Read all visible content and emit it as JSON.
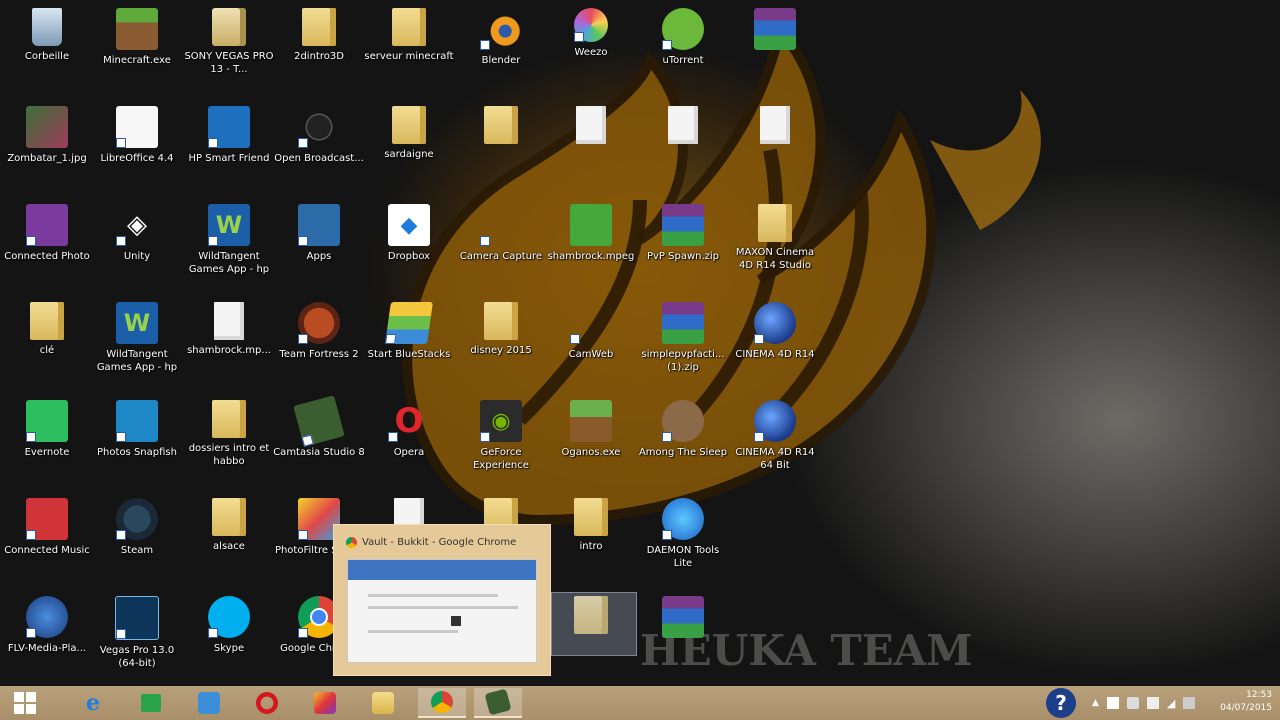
{
  "desktop": {
    "icons": [
      {
        "label": "Corbeille",
        "kind": "bin",
        "shortcut": false
      },
      {
        "label": "Minecraft.exe",
        "kind": "mc",
        "shortcut": false
      },
      {
        "label": "SONY VEGAS PRO 13 - T...",
        "kind": "sony",
        "shortcut": false
      },
      {
        "label": "2dintro3D",
        "kind": "folder",
        "shortcut": false
      },
      {
        "label": "serveur minecraft",
        "kind": "folder",
        "shortcut": false
      },
      {
        "label": "Blender",
        "kind": "blender",
        "shortcut": true
      },
      {
        "label": "Weezo",
        "kind": "weezo",
        "shortcut": true
      },
      {
        "label": "uTorrent",
        "kind": "ut",
        "shortcut": true
      },
      {
        "label": "",
        "kind": "rar",
        "shortcut": false
      },
      {
        "label": "Zombatar_1.jpg",
        "kind": "zombie",
        "shortcut": false
      },
      {
        "label": "LibreOffice 4.4",
        "kind": "lo",
        "shortcut": true
      },
      {
        "label": "HP Smart Friend",
        "kind": "hp",
        "shortcut": true
      },
      {
        "label": "Open Broadcast...",
        "kind": "obs",
        "shortcut": true
      },
      {
        "label": "sardaigne",
        "kind": "folder",
        "shortcut": false
      },
      {
        "label": "",
        "kind": "folder",
        "shortcut": false
      },
      {
        "label": "",
        "kind": "file",
        "shortcut": false
      },
      {
        "label": "",
        "kind": "file",
        "shortcut": false
      },
      {
        "label": "",
        "kind": "file",
        "shortcut": false
      },
      {
        "label": "Connected Photo",
        "kind": "cp",
        "shortcut": true
      },
      {
        "label": "Unity",
        "kind": "unity",
        "shortcut": true
      },
      {
        "label": "WildTangent Games App - hp",
        "kind": "wt",
        "shortcut": true
      },
      {
        "label": "Apps",
        "kind": "apps",
        "shortcut": true
      },
      {
        "label": "Dropbox",
        "kind": "dropbox",
        "shortcut": false
      },
      {
        "label": "Camera Capture",
        "kind": "cam",
        "shortcut": true
      },
      {
        "label": "shambrock.mpeg",
        "kind": "mpeg",
        "shortcut": false
      },
      {
        "label": "PvP Spawn.zip",
        "kind": "rar",
        "shortcut": false
      },
      {
        "label": "MAXON Cinema 4D R14 Studio",
        "kind": "folder",
        "shortcut": false
      },
      {
        "label": "clé",
        "kind": "folder",
        "shortcut": false
      },
      {
        "label": "WildTangent Games App - hp",
        "kind": "wt",
        "shortcut": false
      },
      {
        "label": "shambrock.mp...",
        "kind": "file",
        "shortcut": false
      },
      {
        "label": "Team Fortress 2",
        "kind": "tf2",
        "shortcut": true
      },
      {
        "label": "Start BlueStacks",
        "kind": "bs",
        "shortcut": true
      },
      {
        "label": "disney 2015",
        "kind": "folder",
        "shortcut": false
      },
      {
        "label": "CamWeb",
        "kind": "cam",
        "shortcut": true
      },
      {
        "label": "simplepvpfacti... (1).zip",
        "kind": "rar",
        "shortcut": false
      },
      {
        "label": "CINEMA 4D R14",
        "kind": "c4d",
        "shortcut": true
      },
      {
        "label": "Evernote",
        "kind": "evernote",
        "shortcut": true
      },
      {
        "label": "Photos Snapfish",
        "kind": "snap",
        "shortcut": true
      },
      {
        "label": "dossiers intro et habbo",
        "kind": "folder",
        "shortcut": false
      },
      {
        "label": "Camtasia Studio 8",
        "kind": "camtasia",
        "shortcut": true
      },
      {
        "label": "Opera",
        "kind": "opera",
        "shortcut": true
      },
      {
        "label": "GeForce Experience",
        "kind": "nvidia",
        "shortcut": true
      },
      {
        "label": "Oganos.exe",
        "kind": "mcexe",
        "shortcut": false
      },
      {
        "label": "Among The Sleep",
        "kind": "among",
        "shortcut": true
      },
      {
        "label": "CINEMA 4D R14 64 Bit",
        "kind": "c4d",
        "shortcut": true
      },
      {
        "label": "Connected Music",
        "kind": "music",
        "shortcut": true
      },
      {
        "label": "Steam",
        "kind": "steam",
        "shortcut": true
      },
      {
        "label": "alsace",
        "kind": "folder",
        "shortcut": false
      },
      {
        "label": "PhotoFiltre Studio",
        "kind": "pstudio",
        "shortcut": true
      },
      {
        "label": "",
        "kind": "file",
        "shortcut": false
      },
      {
        "label": "",
        "kind": "folder",
        "shortcut": false
      },
      {
        "label": "intro",
        "kind": "folder",
        "shortcut": false
      },
      {
        "label": "DAEMON Tools Lite",
        "kind": "daemon",
        "shortcut": true
      },
      {
        "label": "",
        "kind": "none",
        "shortcut": false
      },
      {
        "label": "FLV-Media-Pla...",
        "kind": "flv",
        "shortcut": true
      },
      {
        "label": "Vegas Pro 13.0 (64-bit)",
        "kind": "vegas",
        "shortcut": true
      },
      {
        "label": "Skype",
        "kind": "skype",
        "shortcut": true
      },
      {
        "label": "Google Chrome",
        "kind": "chrome",
        "shortcut": true
      },
      {
        "label": "",
        "kind": "none",
        "shortcut": false
      },
      {
        "label": "",
        "kind": "none",
        "shortcut": false
      },
      {
        "label": "",
        "kind": "folder",
        "shortcut": false
      },
      {
        "label": "",
        "kind": "rar",
        "shortcut": false
      },
      {
        "label": "",
        "kind": "none",
        "shortcut": false
      }
    ],
    "watermark_text": "HEUKA TEAM"
  },
  "taskbar_preview": {
    "title": "Vault - Bukkit - Google Chrome"
  },
  "taskbar": {
    "buttons": [
      {
        "name": "start-button",
        "icon": "windows-logo-icon"
      },
      {
        "name": "internet-explorer-button",
        "icon": "internet-explorer-icon"
      },
      {
        "name": "store-button",
        "icon": "store-icon"
      },
      {
        "name": "hp-app-button",
        "icon": "hp-icon"
      },
      {
        "name": "opera-button",
        "icon": "opera-icon"
      },
      {
        "name": "photo-app-button",
        "icon": "photo-app-icon"
      },
      {
        "name": "file-explorer-button",
        "icon": "folder-icon"
      },
      {
        "name": "chrome-button",
        "icon": "chrome-icon"
      },
      {
        "name": "camtasia-button",
        "icon": "camtasia-icon"
      }
    ],
    "clock_time": "12:53",
    "clock_date": "04/07/2015"
  }
}
